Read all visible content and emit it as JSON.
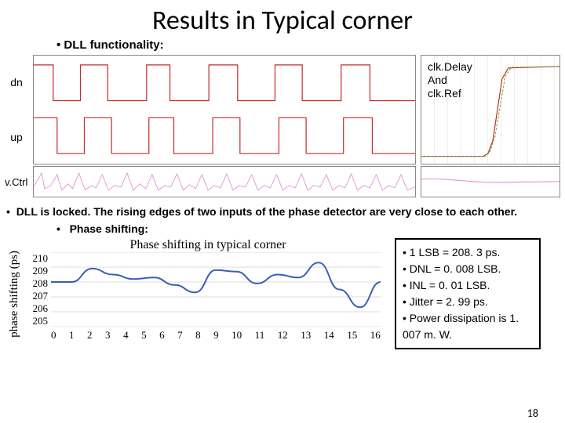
{
  "title": "Results in Typical corner",
  "bullet_dll": "DLL functionality:",
  "sig_labels": {
    "dn": "dn",
    "up": "up",
    "vctrl": "v.Ctrl"
  },
  "right_box": {
    "l1": "clk.Delay",
    "l2": "And",
    "l3": "clk.Ref"
  },
  "locked_text": "DLL is locked. The rising edges of two inputs of  the phase detector are very close to each other.",
  "bullet_ps": "Phase shifting:",
  "chart_data": {
    "type": "line",
    "title": "Phase shifting in typical corner",
    "ylabel": "phase shifting (ps)",
    "xlabel": "",
    "categories": [
      0,
      1,
      2,
      3,
      4,
      5,
      6,
      7,
      8,
      9,
      10,
      11,
      12,
      13,
      14,
      15,
      16
    ],
    "y_ticks": [
      210,
      209,
      208,
      207,
      206,
      205
    ],
    "ylim": [
      205,
      210
    ],
    "values": [
      208.0,
      208.0,
      208.9,
      208.5,
      208.2,
      208.3,
      207.8,
      207.3,
      208.8,
      208.7,
      207.9,
      208.5,
      208.3,
      209.3,
      207.5,
      206.3,
      208.0
    ]
  },
  "results": {
    "r0": "1 LSB = 208. 3 ps.",
    "r1": "DNL = 0. 008 LSB.",
    "r2": "INL =  0. 01 LSB.",
    "r3": "Jitter = 2. 99 ps.",
    "r4": "Power dissipation is 1. 007 m. W."
  },
  "slidenum": "18"
}
